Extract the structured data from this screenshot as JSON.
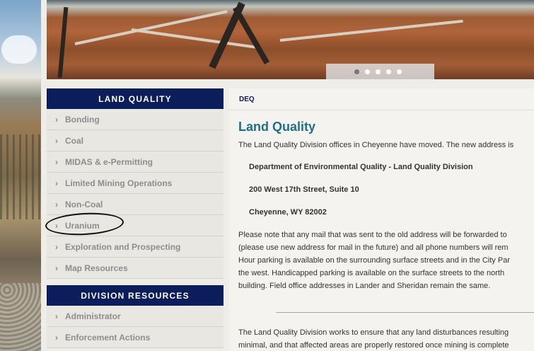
{
  "banner": {
    "slides": [
      {
        "active": true
      },
      {
        "active": false
      },
      {
        "active": false
      },
      {
        "active": false
      },
      {
        "active": false
      }
    ]
  },
  "sidebar": {
    "land_quality": {
      "title": "LAND QUALITY",
      "items": [
        {
          "label": "Bonding"
        },
        {
          "label": "Coal"
        },
        {
          "label": "MIDAS & e-Permitting"
        },
        {
          "label": "Limited Mining Operations"
        },
        {
          "label": "Non-Coal"
        },
        {
          "label": "Uranium"
        },
        {
          "label": "Exploration and Prospecting"
        },
        {
          "label": "Map Resources"
        }
      ]
    },
    "division_resources": {
      "title": "DIVISION RESOURCES",
      "items": [
        {
          "label": "Administrator"
        },
        {
          "label": "Enforcement Actions"
        }
      ]
    }
  },
  "main": {
    "breadcrumb": "DEQ",
    "title": "Land Quality",
    "intro": "The Land Quality Division offices in Cheyenne have moved.  The new address is",
    "address": [
      "Department of Environmental Quality - Land Quality Division",
      "200 West 17th Street, Suite 10",
      "Cheyenne, WY 82002"
    ],
    "notice_lines": [
      "Please note that any mail that was sent to the old address will be forwarded to",
      "(please use new address for mail in the future) and all phone numbers will rem",
      "Hour parking is available on the surrounding surface streets and in the City Par",
      "the west.  Handicapped parking is available on the surface streets to the north",
      "building.  Field office addresses in Lander and Sheridan remain the same."
    ],
    "mission_lines": [
      "The Land Quality Division works to ensure that any land disturbances resulting",
      "minimal, and that affected areas are properly restored once mining is complete"
    ]
  },
  "colors": {
    "header_navy": "#0b1d5b",
    "title_teal": "#1f6f8b",
    "sidebar_text": "#8d8d8d",
    "annotation_ink": "#111111"
  }
}
